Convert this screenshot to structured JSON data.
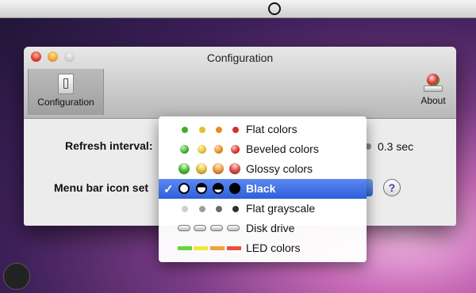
{
  "window": {
    "title": "Configuration",
    "toolbar": [
      {
        "label": "Configuration",
        "icon": "configuration-icon"
      },
      {
        "label": "About",
        "icon": "about-icon"
      }
    ]
  },
  "form": {
    "refresh_label": "Refresh interval:",
    "refresh_value": "0.3 sec",
    "iconset_label": "Menu bar icon set",
    "help_label": "?"
  },
  "dropdown": {
    "items": [
      {
        "label": "Flat colors"
      },
      {
        "label": "Beveled colors"
      },
      {
        "label": "Glossy colors"
      },
      {
        "label": "Black",
        "selected": true
      },
      {
        "label": "Flat grayscale"
      },
      {
        "label": "Disk drive"
      },
      {
        "label": "LED colors"
      }
    ]
  },
  "colors": {
    "selection": "#2d5fd8",
    "green": "#3fae2a",
    "yellow": "#e5c02b",
    "orange": "#e98a1f",
    "red": "#d8312a"
  }
}
